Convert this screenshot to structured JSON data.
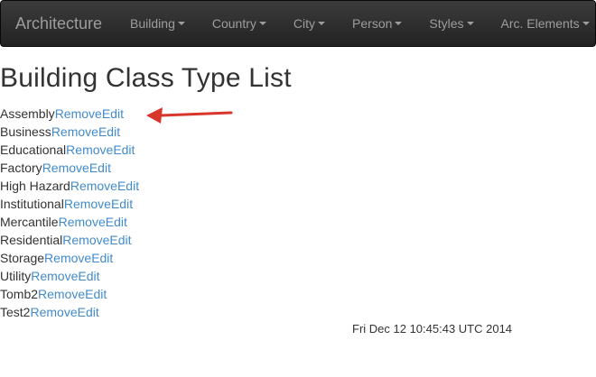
{
  "navbar": {
    "brand": "Architecture",
    "items": [
      {
        "label": "Building"
      },
      {
        "label": "Country"
      },
      {
        "label": "City"
      },
      {
        "label": "Person"
      },
      {
        "label": "Styles"
      },
      {
        "label": "Arc. Elements"
      }
    ]
  },
  "page": {
    "title": "Building Class Type List"
  },
  "rows": [
    {
      "name": "Assembly",
      "remove": "Remove",
      "edit": "Edit"
    },
    {
      "name": "Business",
      "remove": "Remove",
      "edit": "Edit"
    },
    {
      "name": "Educational",
      "remove": "Remove",
      "edit": "Edit"
    },
    {
      "name": "Factory",
      "remove": "Remove",
      "edit": "Edit"
    },
    {
      "name": "High Hazard",
      "remove": "Remove",
      "edit": "Edit"
    },
    {
      "name": "Institutional",
      "remove": "Remove",
      "edit": "Edit"
    },
    {
      "name": "Mercantile",
      "remove": "Remove",
      "edit": "Edit"
    },
    {
      "name": "Residential",
      "remove": "Remove",
      "edit": "Edit"
    },
    {
      "name": "Storage",
      "remove": "Remove",
      "edit": "Edit"
    },
    {
      "name": "Utility",
      "remove": "Remove",
      "edit": "Edit"
    },
    {
      "name": "Tomb2",
      "remove": "Remove",
      "edit": "Edit"
    },
    {
      "name": "Test2",
      "remove": "Remove",
      "edit": "Edit"
    }
  ],
  "footer": {
    "timestamp": "Fri Dec 12 10:45:43 UTC 2014"
  },
  "colors": {
    "navbar_bg": "#222222",
    "nav_text": "#9d9d9d",
    "link": "#428bca",
    "annotation_arrow": "#d9362b"
  }
}
